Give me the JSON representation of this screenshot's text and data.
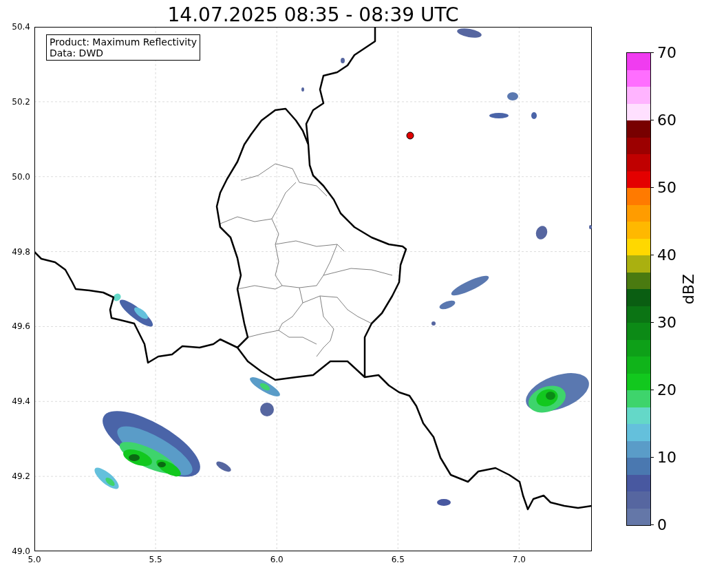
{
  "title": "14.07.2025 08:35 - 08:39 UTC",
  "info_box": {
    "lines": [
      "Product: Maximum Reflectivity",
      "Data: DWD"
    ]
  },
  "map": {
    "xticks": [
      "5.0",
      "5.5",
      "6.0",
      "6.5",
      "7.0"
    ],
    "yticks": [
      "50.4",
      "50.2",
      "50.0",
      "49.8",
      "49.6",
      "49.4",
      "49.2",
      "49.0"
    ]
  },
  "colorbar": {
    "label": "dBZ",
    "ticks": [
      "70",
      "60",
      "50",
      "40",
      "30",
      "20",
      "10",
      "0"
    ],
    "bins": [
      {
        "color": "#6477a8"
      },
      {
        "color": "#5666a0"
      },
      {
        "color": "#4858a0"
      },
      {
        "color": "#4a78b0"
      },
      {
        "color": "#5a9cc8"
      },
      {
        "color": "#64c0dc"
      },
      {
        "color": "#64d8c8"
      },
      {
        "color": "#3ed46c"
      },
      {
        "color": "#12c81e"
      },
      {
        "color": "#10b41a"
      },
      {
        "color": "#0ea018"
      },
      {
        "color": "#0c8a16"
      },
      {
        "color": "#0b7414"
      },
      {
        "color": "#0a5e12"
      },
      {
        "color": "#4a7a10"
      },
      {
        "color": "#aab010"
      },
      {
        "color": "#ffd800"
      },
      {
        "color": "#ffb800"
      },
      {
        "color": "#ff9c00"
      },
      {
        "color": "#ff7a00"
      },
      {
        "color": "#e40000"
      },
      {
        "color": "#c00000"
      },
      {
        "color": "#9c0000"
      },
      {
        "color": "#780000"
      },
      {
        "color": "#ffe0ff"
      },
      {
        "color": "#ffb4ff"
      },
      {
        "color": "#ff6eff"
      },
      {
        "color": "#f03cf0"
      }
    ]
  }
}
